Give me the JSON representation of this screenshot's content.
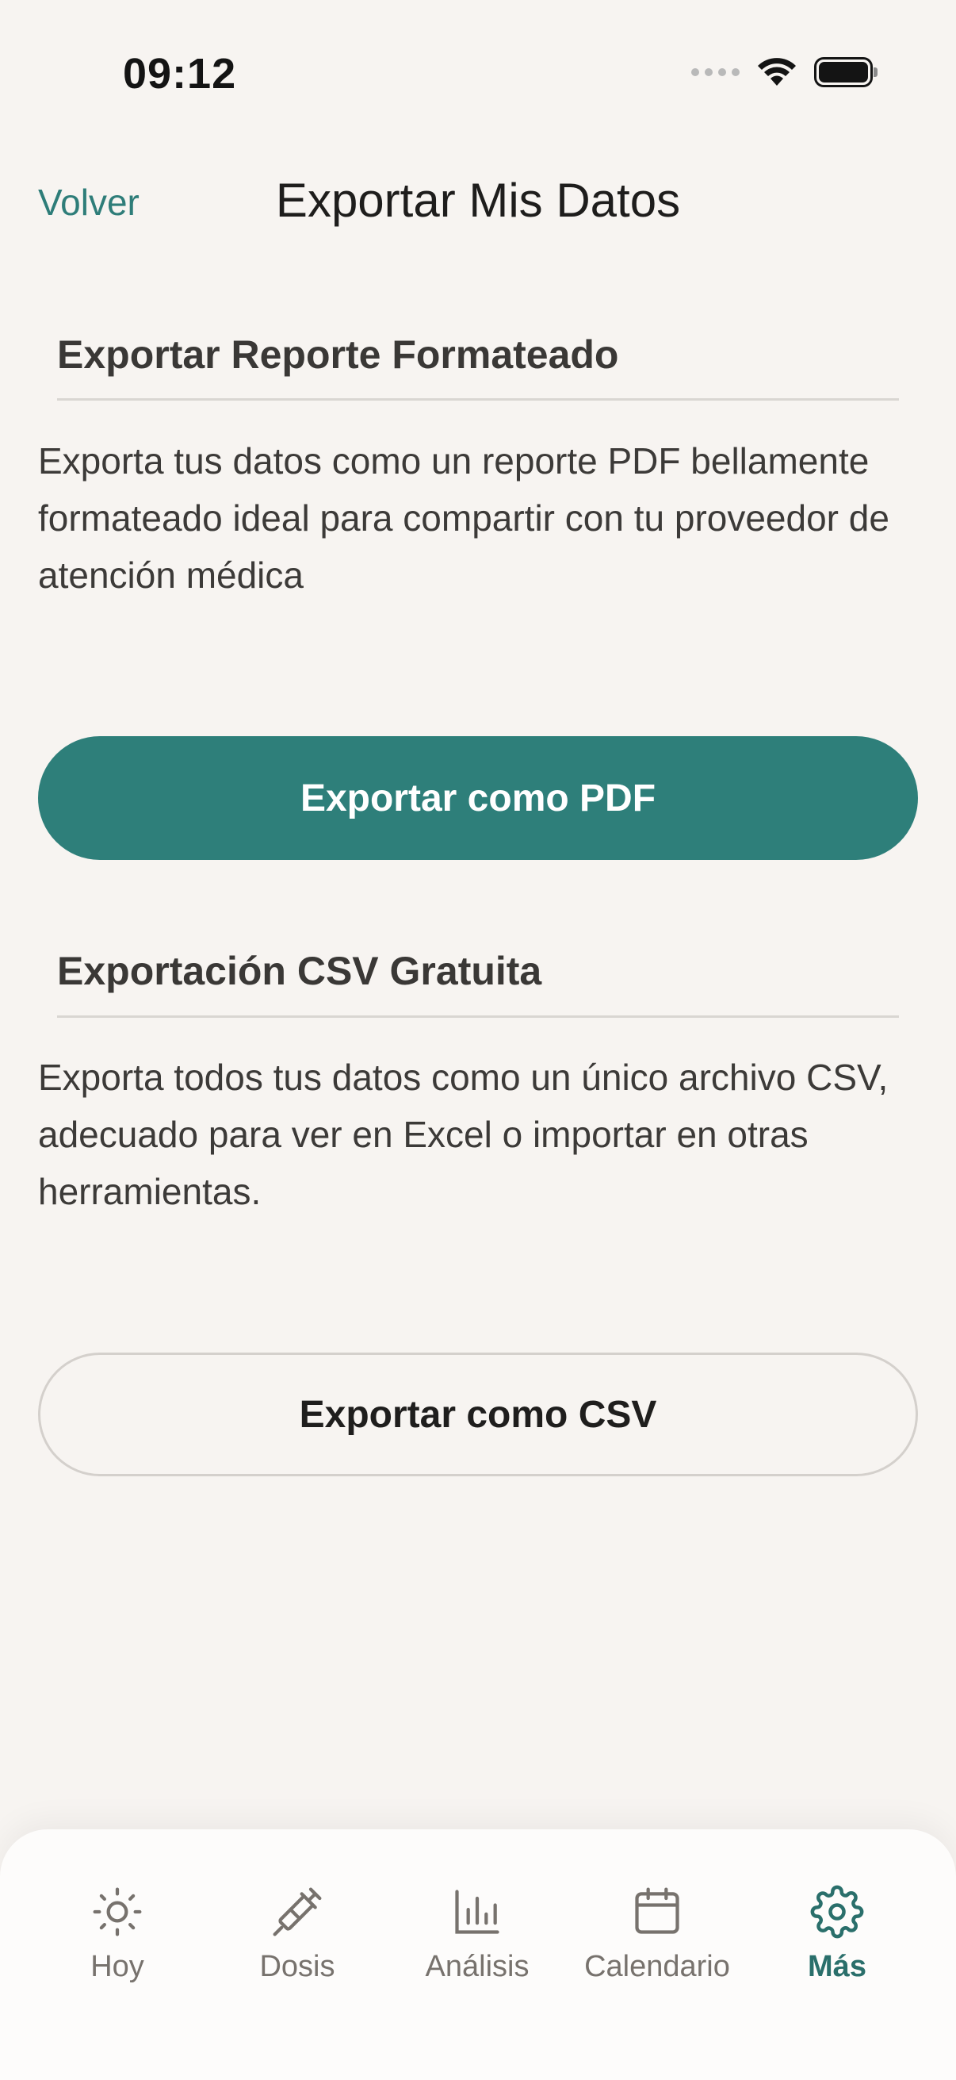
{
  "status_bar": {
    "time": "09:12"
  },
  "header": {
    "back_label": "Volver",
    "title": "Exportar Mis Datos"
  },
  "sections": [
    {
      "title": "Exportar Reporte Formateado",
      "description": "Exporta tus datos como un reporte PDF bellamente formateado ideal para compartir con tu proveedor de atención médica",
      "button_label": "Exportar como PDF"
    },
    {
      "title": "Exportación CSV Gratuita",
      "description": "Exporta todos tus datos como un único archivo CSV, adecuado para ver en Excel o importar en otras herramientas.",
      "button_label": "Exportar como CSV"
    }
  ],
  "tab_bar": {
    "items": [
      {
        "label": "Hoy",
        "icon": "sun-icon"
      },
      {
        "label": "Dosis",
        "icon": "syringe-icon"
      },
      {
        "label": "Análisis",
        "icon": "bar-chart-icon"
      },
      {
        "label": "Calendario",
        "icon": "calendar-icon"
      },
      {
        "label": "Más",
        "icon": "gear-icon",
        "active": true
      }
    ]
  },
  "colors": {
    "accent": "#2E7F7A",
    "background": "#F7F4F1",
    "tab_inactive": "#77726D"
  }
}
